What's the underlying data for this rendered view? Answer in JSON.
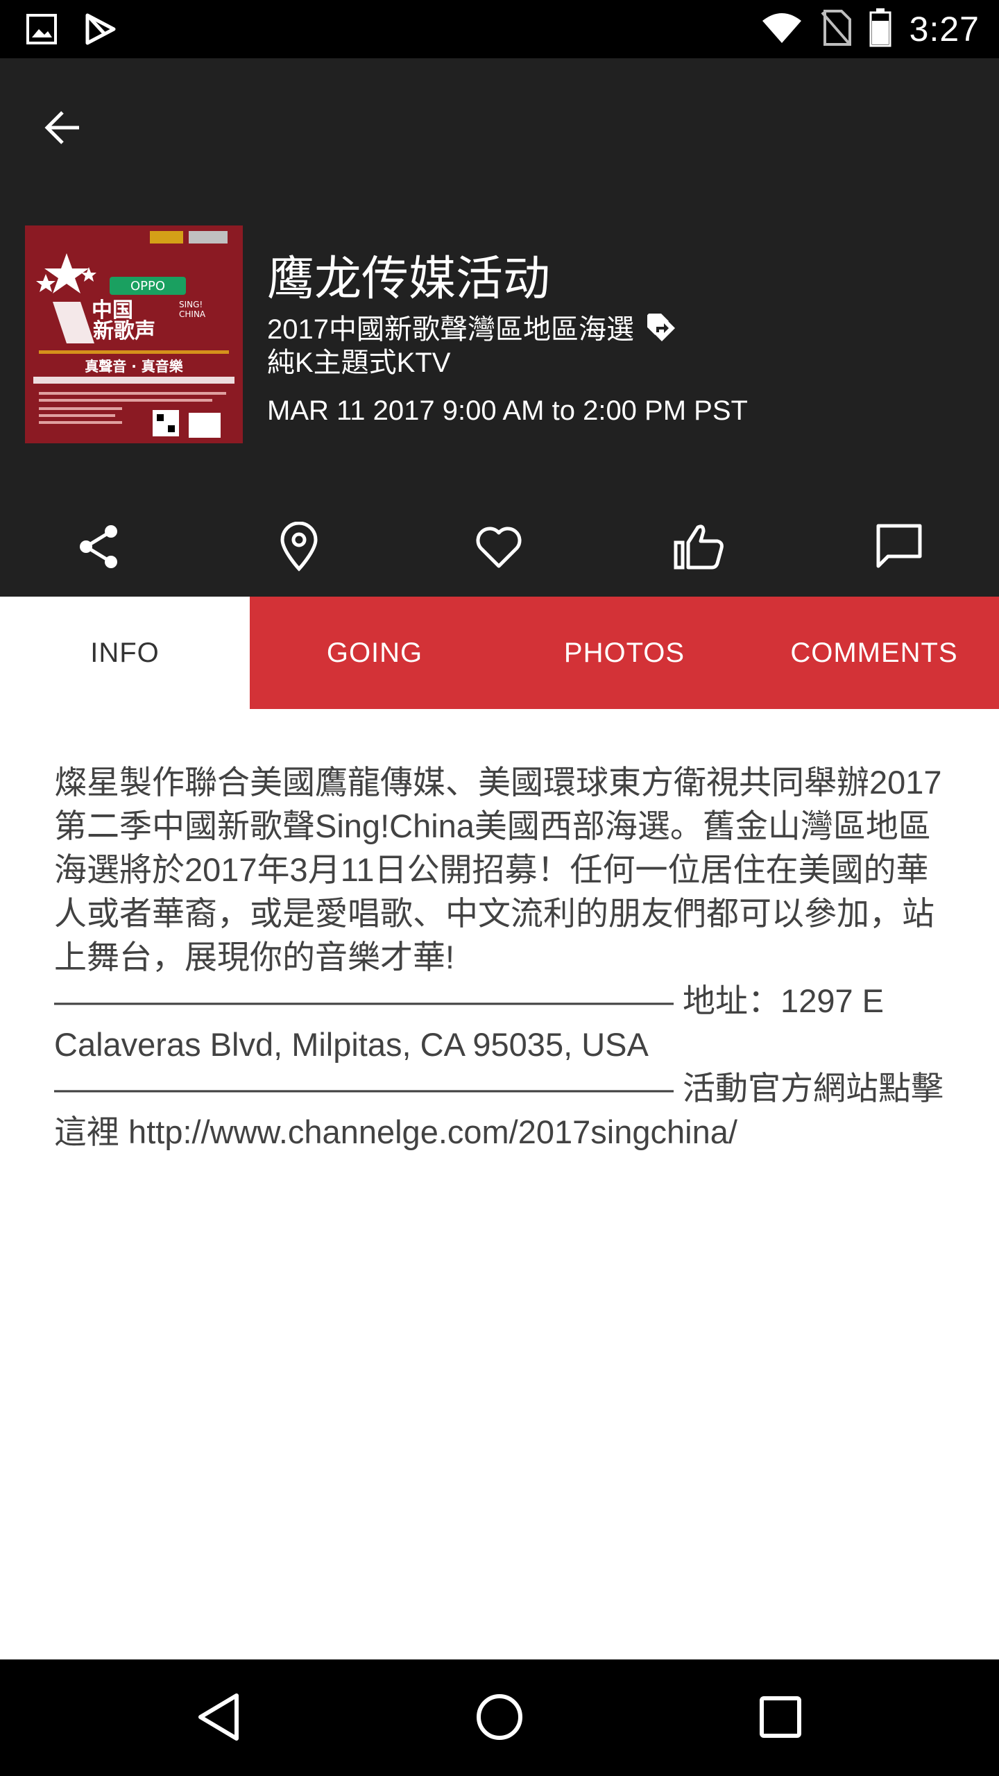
{
  "status_bar": {
    "time": "3:27",
    "left_icons": [
      "image-icon",
      "play-store-icon"
    ],
    "right_icons": [
      "wifi-icon",
      "no-sim-icon",
      "battery-icon"
    ]
  },
  "header": {
    "back_icon": "arrow-left-icon",
    "poster_text": {
      "oppo": "OPPO",
      "brand_line1": "中国",
      "brand_line2": "新歌声",
      "sing": "SING!",
      "china": "CHINA",
      "slogan": "真聲音 · 真音樂"
    },
    "title": "鹰龙传媒活动",
    "venue_line1": "2017中國新歌聲灣區地區海選",
    "venue_line2": "純K主題式KTV",
    "datetime": "MAR 11 2017 9:00 AM to 2:00 PM PST",
    "actions": [
      {
        "name": "share",
        "icon": "share-icon"
      },
      {
        "name": "location",
        "icon": "map-pin-icon"
      },
      {
        "name": "favorite",
        "icon": "heart-icon"
      },
      {
        "name": "like",
        "icon": "thumbs-up-icon"
      },
      {
        "name": "comment",
        "icon": "chat-bubble-icon"
      }
    ]
  },
  "tabs": [
    {
      "label": "INFO",
      "active": true
    },
    {
      "label": "GOING",
      "active": false
    },
    {
      "label": "PHOTOS",
      "active": false
    },
    {
      "label": "COMMENTS",
      "active": false
    }
  ],
  "info": {
    "body": "燦星製作聯合美國鷹龍傳媒、美國環球東方衛視共同舉辦2017第二季中國新歌聲Sing!China美國西部海選。舊金山灣區地區海選將於2017年3月11日公開招募！任何一位居住在美國的華人或者華裔，或是愛唱歌、中文流利的朋友們都可以參加，站上舞台，展現你的音樂才華!\n——————————————————— 地址：1297 E Calaveras Blvd, Milpitas, CA 95035, USA\n——————————————————— 活動官方網站點擊這裡 http://www.channelge.com/2017singchina/"
  },
  "nav_bar": {
    "buttons": [
      "back-triangle-icon",
      "home-circle-icon",
      "recents-square-icon"
    ]
  },
  "colors": {
    "header_bg": "#212121",
    "tab_red": "#d33237",
    "body_text": "#424242"
  }
}
